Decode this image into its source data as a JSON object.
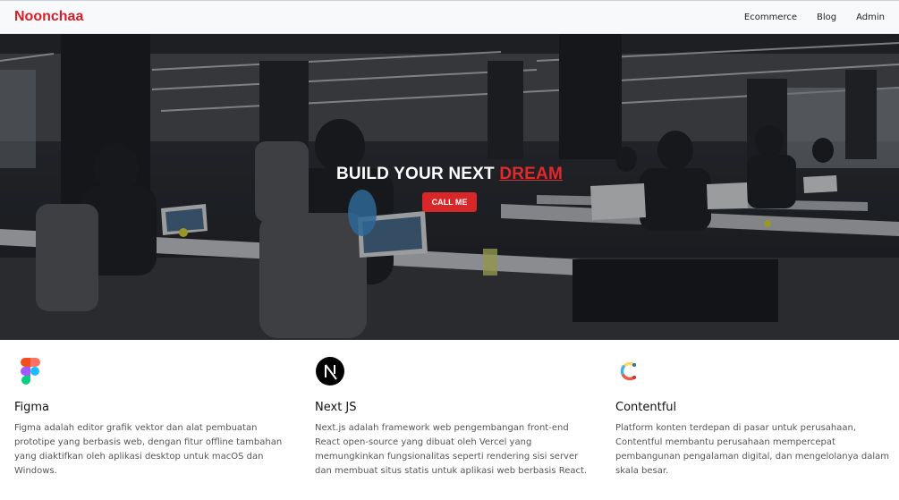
{
  "navbar": {
    "brand": "Noonchaa",
    "links": [
      {
        "label": "Ecommerce"
      },
      {
        "label": "Blog"
      },
      {
        "label": "Admin"
      }
    ]
  },
  "hero": {
    "title_prefix": "BUILD YOUR NEXT",
    "title_accent": "DREAM",
    "cta_label": "CALL ME",
    "accent_color": "#d92628"
  },
  "features": [
    {
      "icon": "figma-icon",
      "title": "Figma",
      "description": "Figma adalah editor grafik vektor dan alat pembuatan prototipe yang berbasis web, dengan fitur offline tambahan yang diaktifkan oleh aplikasi desktop untuk macOS dan Windows."
    },
    {
      "icon": "nextjs-icon",
      "title": "Next JS",
      "description": "Next.js adalah framework web pengembangan front-end React open-source yang dibuat oleh Vercel yang memungkinkan fungsionalitas seperti rendering sisi server dan membuat situs statis untuk aplikasi web berbasis React."
    },
    {
      "icon": "contentful-icon",
      "title": "Contentful",
      "description": "Platform konten terdepan di pasar untuk perusahaan, Contentful membantu perusahaan mempercepat pembangunan pengalaman digital, dan mengelolanya dalam skala besar."
    }
  ]
}
